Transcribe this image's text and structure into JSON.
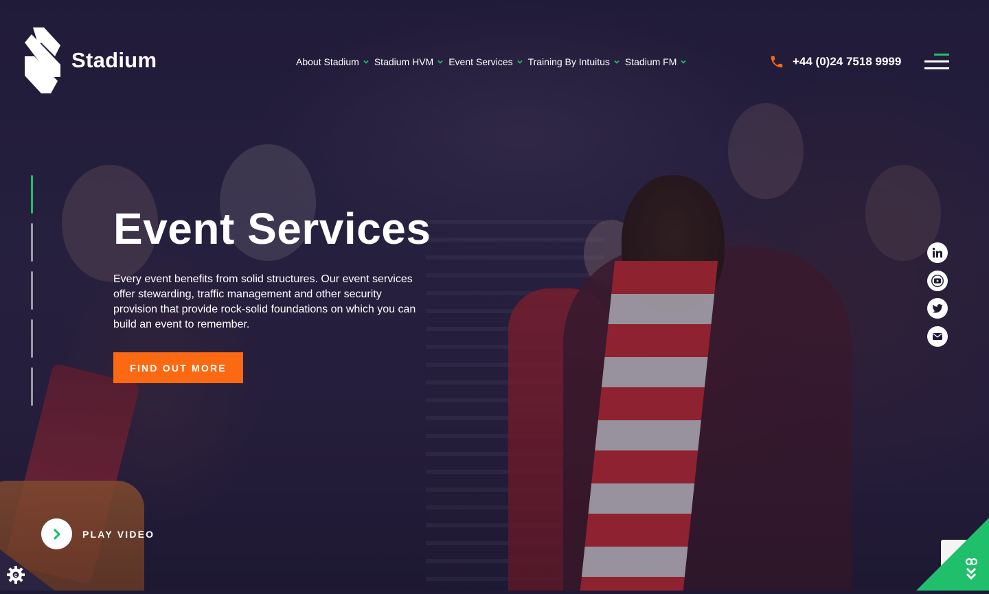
{
  "brand": {
    "name": "Stadium",
    "accent": "#1fbf6c",
    "cta_color": "#fb6a12",
    "dark": "#1e1a36"
  },
  "nav": {
    "items": [
      {
        "label": "About Stadium"
      },
      {
        "label": "Stadium HVM"
      },
      {
        "label": "Event Services"
      },
      {
        "label": "Training By Intuitus"
      },
      {
        "label": "Stadium FM"
      }
    ]
  },
  "header": {
    "phone": "+44 (0)24 7518 9999",
    "phone_icon": "phone-icon",
    "menu_icon": "hamburger-icon"
  },
  "hero": {
    "title": "Event Services",
    "text": "Every event benefits from solid structures. Our event services offer stewarding, traffic management and other security provision that provide rock-solid foundations on which you can build an event to remember.",
    "cta_label": "FIND OUT MORE",
    "slides_total": 5,
    "active_slide": 1
  },
  "video": {
    "label": "PLAY VIDEO"
  },
  "social": [
    {
      "icon": "linkedin-icon"
    },
    {
      "icon": "youtube-icon"
    },
    {
      "icon": "twitter-icon"
    },
    {
      "icon": "email-icon"
    }
  ],
  "widgets": {
    "cookie_icon": "cookie-settings-icon",
    "accessibility_icon": "accessibility-icon"
  }
}
